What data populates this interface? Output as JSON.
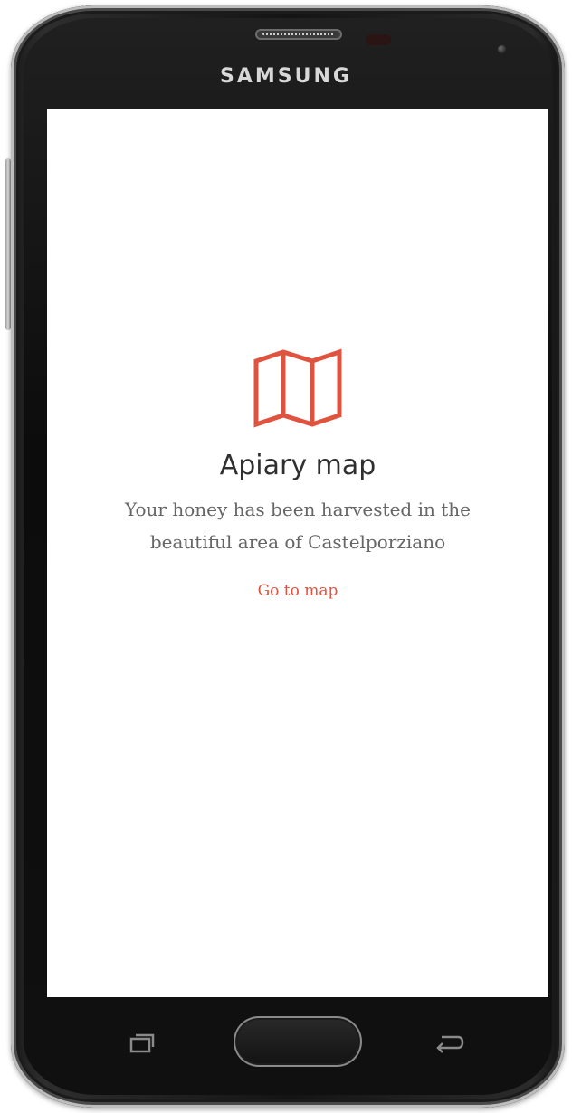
{
  "device": {
    "brand": "SAMSUNG"
  },
  "screen": {
    "icon": "map-icon",
    "title": "Apiary map",
    "description": "Your honey has been harvested in the beautiful area of Castelporziano",
    "link_label": "Go to map"
  },
  "hardware_buttons": {
    "recent": "recent-apps-icon",
    "home": "home-button",
    "back": "back-icon"
  },
  "colors": {
    "accent": "#e0533f",
    "title": "#2f2f2f",
    "body_text": "#666666",
    "screen_bg": "#ffffff",
    "phone_body": "#141414"
  }
}
